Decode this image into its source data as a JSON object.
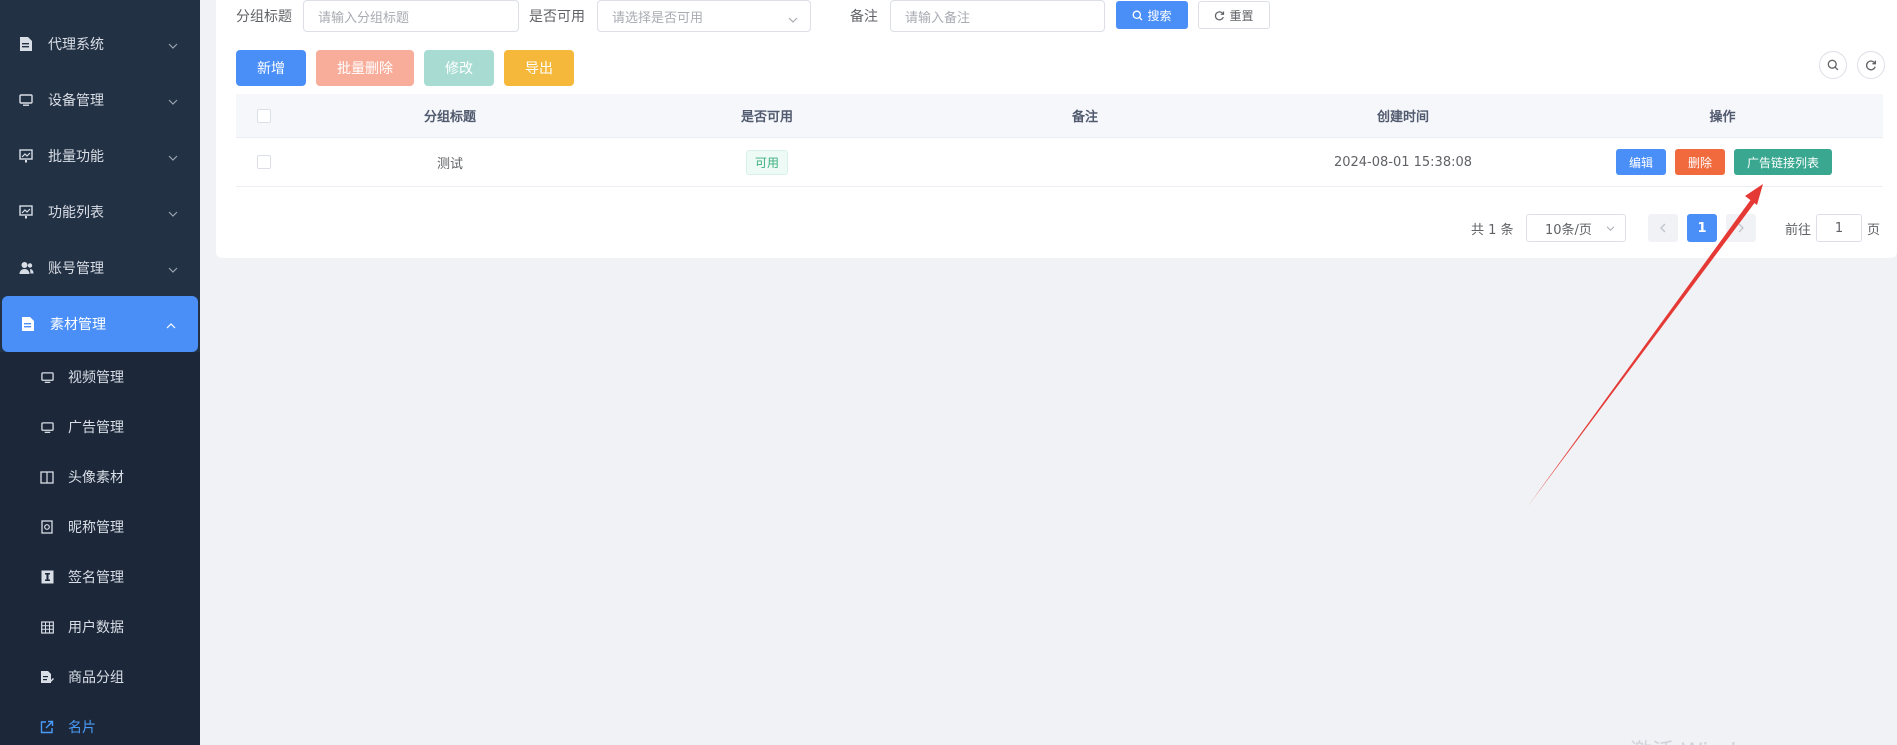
{
  "sidebar": {
    "menu": [
      {
        "label": "代理系统",
        "icon": "document-icon"
      },
      {
        "label": "设备管理",
        "icon": "monitor-icon"
      },
      {
        "label": "批量功能",
        "icon": "monitor-chart-icon"
      },
      {
        "label": "功能列表",
        "icon": "monitor-chart-icon"
      },
      {
        "label": "账号管理",
        "icon": "users-icon"
      },
      {
        "label": "素材管理",
        "icon": "document-icon",
        "active": true
      }
    ],
    "submenu": [
      {
        "label": "视频管理",
        "icon": "monitor-icon"
      },
      {
        "label": "广告管理",
        "icon": "monitor-icon"
      },
      {
        "label": "头像素材",
        "icon": "book-icon"
      },
      {
        "label": "昵称管理",
        "icon": "circle-frame-icon"
      },
      {
        "label": "签名管理",
        "icon": "text-box-icon"
      },
      {
        "label": "用户数据",
        "icon": "grid-icon"
      },
      {
        "label": "商品分组",
        "icon": "doc-edit-icon"
      },
      {
        "label": "名片",
        "icon": "external-link-icon"
      }
    ]
  },
  "filters": {
    "group_title_label": "分组标题",
    "group_title_placeholder": "请输入分组标题",
    "enabled_label": "是否可用",
    "enabled_placeholder": "请选择是否可用",
    "remark_label": "备注",
    "remark_placeholder": "请输入备注",
    "search_label": "搜索",
    "reset_label": "重置"
  },
  "toolbar": {
    "add": "新增",
    "batch_delete": "批量删除",
    "modify": "修改",
    "export": "导出"
  },
  "colors": {
    "primary": "#4a8ff7",
    "danger_light": "#f8ad9b",
    "success_light": "#a8dcd2",
    "warning": "#f6b83b",
    "danger": "#f06a3e",
    "teal": "#3aa890",
    "arrow": "#e53935"
  },
  "table": {
    "columns": [
      "分组标题",
      "是否可用",
      "备注",
      "创建时间",
      "操作"
    ],
    "rows": [
      {
        "title": "测试",
        "enabled": "可用",
        "remark": "",
        "created": "2024-08-01 15:38:08"
      }
    ],
    "ops": {
      "edit": "编辑",
      "delete": "删除",
      "ad_links": "广告链接列表"
    }
  },
  "pagination": {
    "total": "共 1 条",
    "page_size": "10条/页",
    "current_page": "1",
    "goto_label": "前往",
    "goto_value": "1",
    "page_suffix": "页"
  },
  "watermark": "激活 Windows"
}
